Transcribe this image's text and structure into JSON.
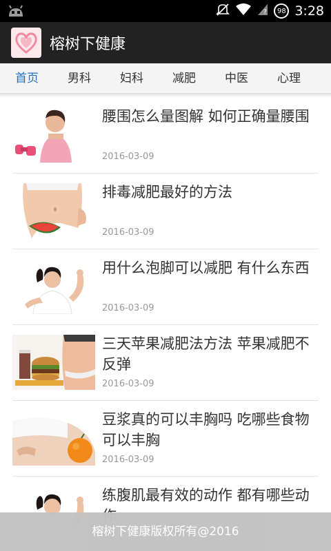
{
  "status_bar": {
    "time": "3:28",
    "battery": "98"
  },
  "app": {
    "title": "榕树下健康",
    "logo_icon": "heart-hands-logo"
  },
  "tabs": [
    {
      "label": "首页",
      "active": true
    },
    {
      "label": "男科",
      "active": false
    },
    {
      "label": "妇科",
      "active": false
    },
    {
      "label": "减肥",
      "active": false
    },
    {
      "label": "中医",
      "active": false
    },
    {
      "label": "心理",
      "active": false
    }
  ],
  "articles": [
    {
      "title": "腰围怎么量图解 如何正确量腰围",
      "date": "2016-03-09",
      "thumb": "woman-with-dumbbells"
    },
    {
      "title": "排毒减肥最好的方法",
      "date": "2016-03-09",
      "thumb": "waist-with-watermelon"
    },
    {
      "title": "用什么泡脚可以减肥 有什么东西",
      "date": "2016-03-09",
      "thumb": "woman-stretching"
    },
    {
      "title": "三天苹果减肥法方法 苹果减肥不反弹",
      "date": "2016-03-09",
      "thumb": "burger-and-waist"
    },
    {
      "title": "豆浆真的可以丰胸吗 吃哪些食物可以丰胸",
      "date": "2016-03-09",
      "thumb": "orange-on-hip"
    },
    {
      "title": "练腹肌最有效的动作 都有哪些动作",
      "date": "",
      "thumb": "woman-stretching"
    }
  ],
  "footer": {
    "text": "榕树下健康版权所有@2016"
  }
}
